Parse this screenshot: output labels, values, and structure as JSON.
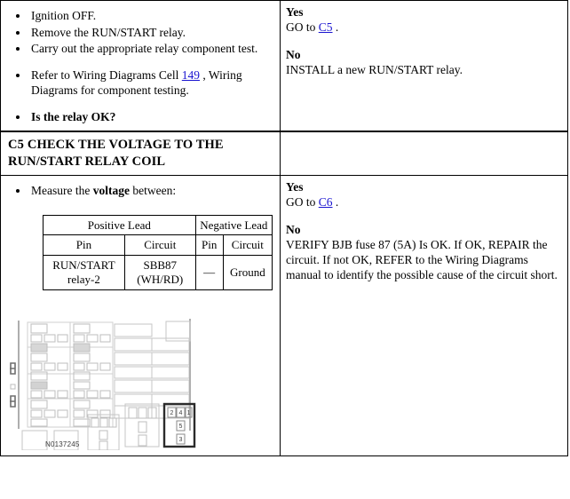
{
  "document": {
    "type": "diagnostic-pinpoint-test",
    "figure_id": "N0137245"
  },
  "rows": [
    {
      "id": "c4-continued",
      "procedure": {
        "bullets": [
          {
            "text": "Ignition OFF.",
            "bold": false,
            "spaced": false
          },
          {
            "text": "Remove the RUN/START relay.",
            "bold": false,
            "spaced": false
          },
          {
            "text": "Carry out the appropriate relay component test.",
            "bold": false,
            "spaced": false
          },
          {
            "text": "Refer to Wiring Diagrams Cell 149 , Wiring Diagrams for component testing.",
            "bold": false,
            "spaced": true,
            "link": "149"
          },
          {
            "text": "Is the relay OK?",
            "bold": true,
            "spaced": true
          }
        ]
      },
      "answers": {
        "yes_label": "Yes",
        "yes_text_pre": "GO to ",
        "yes_link": "C5",
        "yes_text_post": " .",
        "no_label": "No",
        "no_text": "INSTALL a new RUN/START relay."
      }
    },
    {
      "id": "c5",
      "heading": {
        "step_id": "C5",
        "title": "CHECK THE VOLTAGE TO THE RUN/START RELAY COIL"
      },
      "procedure": {
        "bullets": [
          {
            "text_pre": "Measure the ",
            "text_bold": "voltage",
            "text_post": " between:"
          }
        ]
      },
      "lead_table": {
        "group_headers": [
          "Positive Lead",
          "Negative Lead"
        ],
        "column_headers": [
          "Pin",
          "Circuit",
          "Pin",
          "Circuit"
        ],
        "rows": [
          [
            "RUN/START relay-2",
            "SBB87 (WH/RD)",
            "—",
            "Ground"
          ]
        ]
      },
      "answers": {
        "yes_label": "Yes",
        "yes_text_pre": "GO to ",
        "yes_link": "C6",
        "yes_text_post": " .",
        "no_label": "No",
        "no_text": "VERIFY BJB fuse 87 (5A) Is OK. If OK, REPAIR the circuit. If not OK, REFER to the Wiring Diagrams manual to identify the possible cause of the circuit short."
      }
    }
  ],
  "figure": {
    "id": "N0137245",
    "highlighted_relay_pins": [
      "2",
      "4",
      "1",
      "5",
      "3"
    ],
    "description": "Battery junction box fuse and relay layout with RUN/START relay socket highlighted"
  },
  "colors": {
    "link": "#1a14d0",
    "border": "#000000",
    "text": "#000000",
    "figure_line": "#b9b9b9",
    "figure_highlight": "#2b2b2b"
  }
}
